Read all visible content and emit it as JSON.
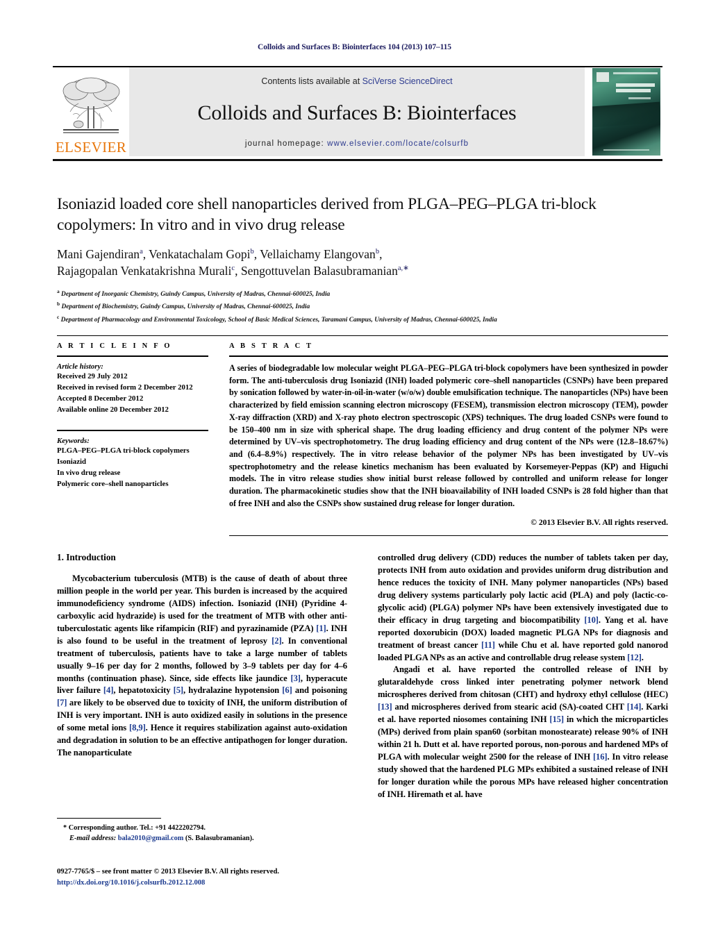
{
  "running_head": "Colloids and Surfaces B: Biointerfaces 104 (2013) 107–115",
  "masthead": {
    "contents_prefix": "Contents lists available at ",
    "contents_link": "SciVerse ScienceDirect",
    "journal_title": "Colloids and Surfaces B: Biointerfaces",
    "homepage_prefix": "journal homepage: ",
    "homepage_url": "www.elsevier.com/locate/colsurfb",
    "publisher_logo_text": "ELSEVIER",
    "cover_title_line1": "COLLOIDS AND",
    "cover_title_line2": "SURFACES B",
    "cover_subtitle": "Biointerfaces",
    "link_color": "#2d3b8f",
    "logo_color": "#E8760B",
    "cover_color": "#2f6d5c"
  },
  "article": {
    "title": "Isoniazid loaded core shell nanoparticles derived from PLGA–PEG–PLGA tri-block copolymers: In vitro and in vivo drug release",
    "authors_line1_parts": [
      {
        "name": "Mani Gajendiran",
        "sup": "a",
        "sep": ", "
      },
      {
        "name": "Venkatachalam Gopi",
        "sup": "b",
        "sep": ", "
      },
      {
        "name": "Vellaichamy Elangovan",
        "sup": "b",
        "sep": ","
      }
    ],
    "authors_line2_parts": [
      {
        "name": "Rajagopalan Venkatakrishna Murali",
        "sup": "c",
        "sep": ", "
      },
      {
        "name": "Sengottuvelan Balasubramanian",
        "sup": "a,∗",
        "sep": ""
      }
    ],
    "affiliations": [
      {
        "mark": "a",
        "text": "Department of Inorganic Chemistry, Guindy Campus, University of Madras, Chennai-600025, India"
      },
      {
        "mark": "b",
        "text": "Department of Biochemistry, Guindy Campus, University of Madras, Chennai-600025, India"
      },
      {
        "mark": "c",
        "text": "Department of Pharmacology and Environmental Toxicology, School of Basic Medical Sciences, Taramani Campus, University of Madras, Chennai-600025, India"
      }
    ]
  },
  "info": {
    "heading": "A R T I C L E    I N F O",
    "history_label": "Article history:",
    "history": [
      "Received 29 July 2012",
      "Received in revised form 2 December 2012",
      "Accepted 8 December 2012",
      "Available online 20 December 2012"
    ],
    "keywords_label": "Keywords:",
    "keywords": [
      "PLGA–PEG–PLGA tri-block copolymers",
      "Isoniazid",
      "In vivo drug release",
      "Polymeric core–shell nanoparticles"
    ]
  },
  "abstract": {
    "heading": "A B S T R A C T",
    "text": "A series of biodegradable low molecular weight PLGA–PEG–PLGA tri-block copolymers have been synthesized in powder form. The anti-tuberculosis drug Isoniazid (INH) loaded polymeric core–shell nanoparticles (CSNPs) have been prepared by sonication followed by water-in-oil-in-water (w/o/w) double emulsification technique. The nanoparticles (NPs) have been characterized by field emission scanning electron microscopy (FESEM), transmission electron microscopy (TEM), powder X-ray diffraction (XRD) and X-ray photo electron spectroscopic (XPS) techniques. The drug loaded CSNPs were found to be 150–400 nm in size with spherical shape. The drug loading efficiency and drug content of the polymer NPs were determined by UV–vis spectrophotometry. The drug loading efficiency and drug content of the NPs were (12.8–18.67%) and (6.4–8.9%) respectively. The in vitro release behavior of the polymer NPs has been investigated by UV–vis spectrophotometry and the release kinetics mechanism has been evaluated by Korsemeyer-Peppas (KP) and Higuchi models. The in vitro release studies show initial burst release followed by controlled and uniform release for longer duration. The pharmacokinetic studies show that the INH bioavailability of INH loaded CSNPs is 28 fold higher than that of free INH and also the CSNPs show sustained drug release for longer duration.",
    "copyright": "© 2013 Elsevier B.V. All rights reserved."
  },
  "body": {
    "section_heading": "1.  Introduction",
    "left_paragraphs": [
      "Mycobacterium tuberculosis (MTB) is the cause of death of about three million people in the world per year. This burden is increased by the acquired immunodeficiency syndrome (AIDS) infection. Isoniazid (INH) (Pyridine 4-carboxylic acid hydrazide) is used for the treatment of MTB with other anti-tuberculostatic agents like rifampicin (RIF) and pyrazinamide (PZA) [1]. INH is also found to be useful in the treatment of leprosy [2]. In conventional treatment of tuberculosis, patients have to take a large number of tablets usually 9–16 per day for 2 months, followed by 3–9 tablets per day for 4–6 months (continuation phase). Since, side effects like jaundice [3], hyperacute liver failure [4], hepatotoxicity [5], hydralazine hypotension [6] and poisoning [7] are likely to be observed due to toxicity of INH, the uniform distribution of INH is very important. INH is auto oxidized easily in solutions in the presence of some metal ions [8,9]. Hence it requires stabilization against auto-oxidation and degradation in solution to be an effective antipathogen for longer duration. The nanoparticulate"
    ],
    "right_paragraphs": [
      "controlled drug delivery (CDD) reduces the number of tablets taken per day, protects INH from auto oxidation and provides uniform drug distribution and hence reduces the toxicity of INH. Many polymer nanoparticles (NPs) based drug delivery systems particularly poly lactic acid (PLA) and poly (lactic-co-glycolic acid) (PLGA) polymer NPs have been extensively investigated due to their efficacy in drug targeting and biocompatibility [10]. Yang et al. have reported doxorubicin (DOX) loaded magnetic PLGA NPs for diagnosis and treatment of breast cancer [11] while Chu et al. have reported gold nanorod loaded PLGA NPs as an active and controllable drug release system [12].",
      "Angadi et al. have reported the controlled release of INH by glutaraldehyde cross linked inter penetrating polymer network blend microspheres derived from chitosan (CHT) and hydroxy ethyl cellulose (HEC) [13] and microspheres derived from stearic acid (SA)-coated CHT [14]. Karki et al. have reported niosomes containing INH [15] in which the microparticles (MPs) derived from plain span60 (sorbitan monostearate) release 90% of INH within 21 h. Dutt et al. have reported porous, non-porous and hardened MPs of PLGA with molecular weight 2500 for the release of INH [16]. In vitro release study showed that the hardened PLG MPs exhibited a sustained release of INH for longer duration while the porous MPs have released higher concentration of INH. Hiremath et al. have"
    ],
    "reference_color": "#1b3a8f"
  },
  "footnote": {
    "corresponding": "* Corresponding author. Tel.: +91 4422202794.",
    "email_label": "E-mail address:",
    "email": "bala2010@gmail.com",
    "email_owner": "(S. Balasubramanian)."
  },
  "imprint": {
    "line1": "0927-7765/$ – see front matter © 2013 Elsevier B.V. All rights reserved.",
    "doi": "http://dx.doi.org/10.1016/j.colsurfb.2012.12.008"
  }
}
